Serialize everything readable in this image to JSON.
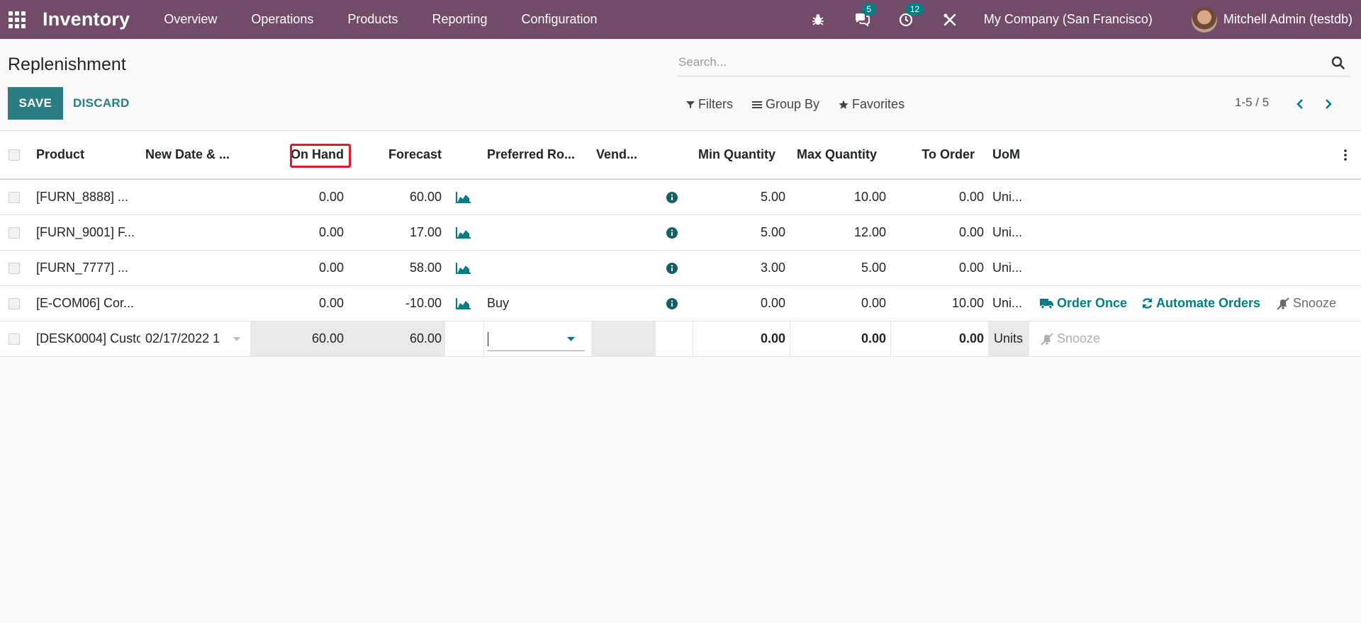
{
  "navbar": {
    "brand": "Inventory",
    "menu": [
      "Overview",
      "Operations",
      "Products",
      "Reporting",
      "Configuration"
    ],
    "chat_count": "5",
    "activity_count": "12",
    "company": "My Company (San Francisco)",
    "user": "Mitchell Admin (testdb)",
    "icons": [
      "apps-grid-icon",
      "bug-icon",
      "chat-icon",
      "clock-icon",
      "tools-icon"
    ]
  },
  "control_panel": {
    "title": "Replenishment",
    "save": "SAVE",
    "discard": "DISCARD",
    "search_placeholder": "Search...",
    "filters": "Filters",
    "group_by": "Group By",
    "favorites": "Favorites",
    "pager": "1-5 / 5"
  },
  "table": {
    "headers": {
      "product": "Product",
      "new_date": "New Date & ...",
      "on_hand": "On Hand",
      "forecast": "Forecast",
      "route": "Preferred Ro...",
      "vendor": "Vend...",
      "min": "Min Quantity",
      "max": "Max Quantity",
      "to_order": "To Order",
      "uom": "UoM"
    },
    "rows": [
      {
        "product": "[FURN_8888] ...",
        "new_date": "",
        "on_hand": "0.00",
        "forecast": "60.00",
        "route": "",
        "min": "5.00",
        "max": "10.00",
        "to_order": "0.00",
        "uom": "Uni..."
      },
      {
        "product": "[FURN_9001] F...",
        "new_date": "",
        "on_hand": "0.00",
        "forecast": "17.00",
        "route": "",
        "min": "5.00",
        "max": "12.00",
        "to_order": "0.00",
        "uom": "Uni..."
      },
      {
        "product": "[FURN_7777] ...",
        "new_date": "",
        "on_hand": "0.00",
        "forecast": "58.00",
        "route": "",
        "min": "3.00",
        "max": "5.00",
        "to_order": "0.00",
        "uom": "Uni..."
      },
      {
        "product": "[E-COM06] Cor...",
        "new_date": "",
        "on_hand": "0.00",
        "forecast": "-10.00",
        "route": "Buy",
        "min": "0.00",
        "max": "0.00",
        "to_order": "10.00",
        "uom": "Uni...",
        "order_once": "Order Once",
        "automate": "Automate Orders",
        "snooze": "Snooze"
      }
    ],
    "edit_row": {
      "product": "[DESK0004] Custo",
      "new_date": "02/17/2022 1",
      "on_hand": "60.00",
      "forecast": "60.00",
      "min": "0.00",
      "max": "0.00",
      "to_order": "0.00",
      "uom": "Units",
      "snooze": "Snooze"
    }
  },
  "colors": {
    "navbar": "#714b67",
    "accent": "#017e84",
    "save_button": "#2a7d80",
    "highlight": "#e8182a"
  }
}
